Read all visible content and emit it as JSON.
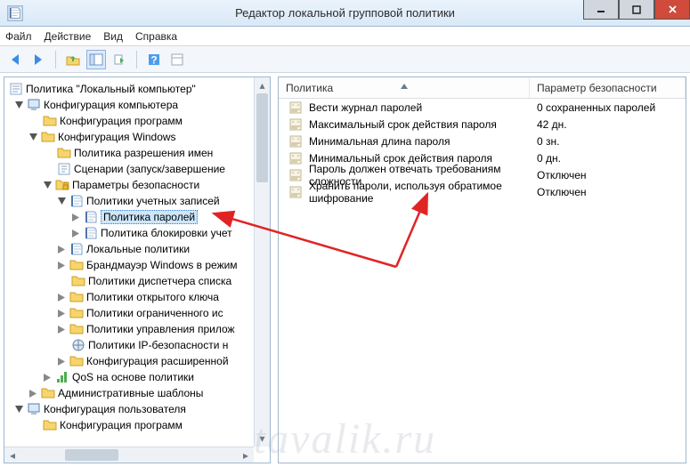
{
  "window": {
    "title": "Редактор локальной групповой политики"
  },
  "menu": {
    "file": "Файл",
    "action": "Действие",
    "view": "Вид",
    "help": "Справка"
  },
  "tree": {
    "root": "Политика \"Локальный компьютер\"",
    "computer_config": "Конфигурация компьютера",
    "software_config": "Конфигурация программ",
    "windows_config": "Конфигурация Windows",
    "name_resolution": "Политика разрешения имен",
    "scripts": "Сценарии (запуск/завершение",
    "security_settings": "Параметры безопасности",
    "account_policies": "Политики учетных записей",
    "password_policy": "Политика паролей",
    "lockout_policy": "Политика блокировки учет",
    "local_policies": "Локальные политики",
    "windows_firewall": "Брандмауэр Windows в режим",
    "dispatcher_policies": "Политики диспетчера списка",
    "public_key": "Политики открытого ключа",
    "restricted_software": "Политики ограниченного ис",
    "app_control": "Политики управления прилож",
    "ipsec": "Политики IP-безопасности н",
    "advanced_audit": "Конфигурация расширенной",
    "qos": "QoS на основе политики",
    "admin_templates": "Административные шаблоны",
    "user_config": "Конфигурация пользователя",
    "user_software_config": "Конфигурация программ"
  },
  "list": {
    "header_policy": "Политика",
    "header_param": "Параметр безопасности",
    "rows": [
      {
        "name": "Вести журнал паролей",
        "value": "0 сохраненных паролей"
      },
      {
        "name": "Максимальный срок действия пароля",
        "value": "42 дн."
      },
      {
        "name": "Минимальная длина пароля",
        "value": "0 зн."
      },
      {
        "name": "Минимальный срок действия пароля",
        "value": "0 дн."
      },
      {
        "name": "Пароль должен отвечать требованиям сложности",
        "value": "Отключен"
      },
      {
        "name": "Хранить пароли, используя обратимое шифрование",
        "value": "Отключен"
      }
    ]
  },
  "watermark": "tavalik.ru"
}
